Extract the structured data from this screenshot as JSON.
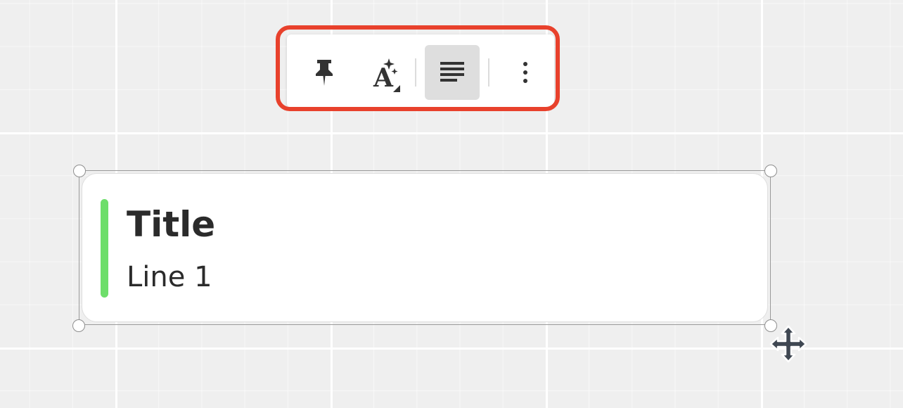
{
  "toolbar": {
    "buttons": [
      {
        "id": "pin",
        "icon": "pin-icon"
      },
      {
        "id": "text-style",
        "icon": "text-style-sparkle-icon"
      },
      {
        "id": "align",
        "icon": "align-justify-icon",
        "active": true
      },
      {
        "id": "more",
        "icon": "more-vertical-icon"
      }
    ],
    "highlight_color": "#e8412c",
    "active_bg": "#dedede"
  },
  "card": {
    "title": "Title",
    "line": "Line 1",
    "accent_color": "#6dde6a",
    "selected": true
  },
  "cursor": {
    "icon": "move-cursor-icon"
  }
}
